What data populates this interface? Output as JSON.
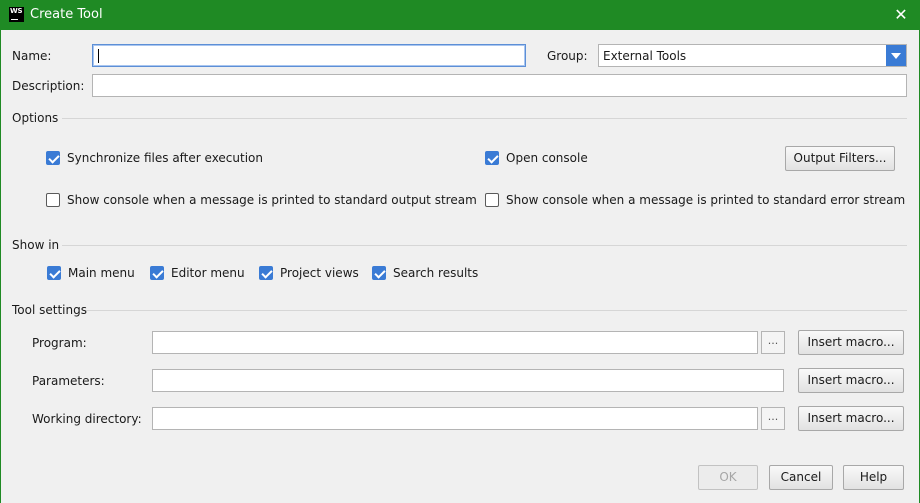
{
  "window": {
    "title": "Create Tool",
    "icon_text": "WS",
    "close_glyph": "✕"
  },
  "form": {
    "name_label": "Name:",
    "name_value": "",
    "group_label": "Group:",
    "group_value": "External Tools",
    "description_label": "Description:",
    "description_value": ""
  },
  "options": {
    "title": "Options",
    "sync_files": {
      "label": "Synchronize files after execution",
      "checked": true
    },
    "open_console": {
      "label": "Open console",
      "checked": true
    },
    "output_filters_button": "Output Filters...",
    "show_console_stdout": {
      "label": "Show console when a message is printed to standard output stream",
      "checked": false
    },
    "show_console_stderr": {
      "label": "Show console when a message is printed to standard error stream",
      "checked": false
    }
  },
  "show_in": {
    "title": "Show in",
    "main_menu": {
      "label": "Main menu",
      "checked": true
    },
    "editor_menu": {
      "label": "Editor menu",
      "checked": true
    },
    "project_views": {
      "label": "Project views",
      "checked": true
    },
    "search_results": {
      "label": "Search results",
      "checked": true
    }
  },
  "tool_settings": {
    "title": "Tool settings",
    "program_label": "Program:",
    "program_value": "",
    "parameters_label": "Parameters:",
    "parameters_value": "",
    "working_directory_label": "Working directory:",
    "working_directory_value": "",
    "insert_macro_label": "Insert macro...",
    "browse_label": "..."
  },
  "footer": {
    "ok_label": "OK",
    "ok_enabled": false,
    "cancel_label": "Cancel",
    "help_label": "Help"
  },
  "colors": {
    "titlebar": "#1f8a24",
    "accent": "#3a7bd5",
    "background": "#f0f0f0"
  }
}
